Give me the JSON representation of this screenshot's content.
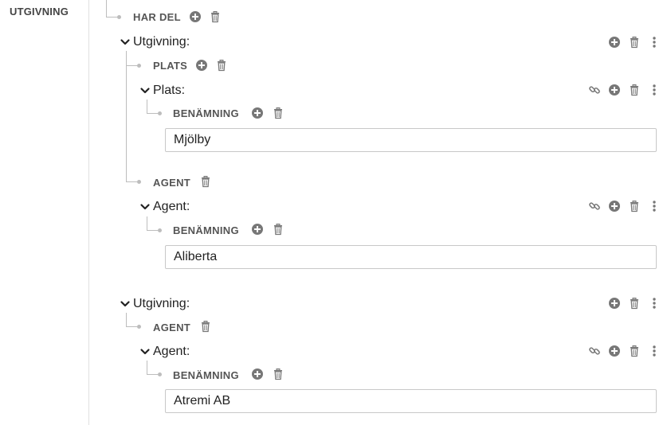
{
  "section": {
    "label": "UTGIVNING"
  },
  "tree": {
    "har_del": {
      "label": "HAR DEL"
    },
    "utgivning_1": {
      "title": "Utgivning:",
      "plats_prop": {
        "label": "PLATS"
      },
      "plats_entity": {
        "title": "Plats:",
        "benamning": {
          "label": "BENÄMNING",
          "value": "Mjölby"
        }
      },
      "agent_prop": {
        "label": "AGENT"
      },
      "agent_entity": {
        "title": "Agent:",
        "benamning": {
          "label": "BENÄMNING",
          "value": "Aliberta"
        }
      }
    },
    "utgivning_2": {
      "title": "Utgivning:",
      "agent_prop": {
        "label": "AGENT"
      },
      "agent_entity": {
        "title": "Agent:",
        "benamning": {
          "label": "BENÄMNING",
          "value": "Atremi AB"
        }
      }
    }
  },
  "icons": {
    "add": "add-icon",
    "delete": "trash-icon",
    "link": "link-icon",
    "more": "more-vertical-icon",
    "expand": "chevron-down-icon"
  },
  "colors": {
    "icon": "#777777",
    "tree_line": "#bdbdbd",
    "label": "#555555"
  }
}
